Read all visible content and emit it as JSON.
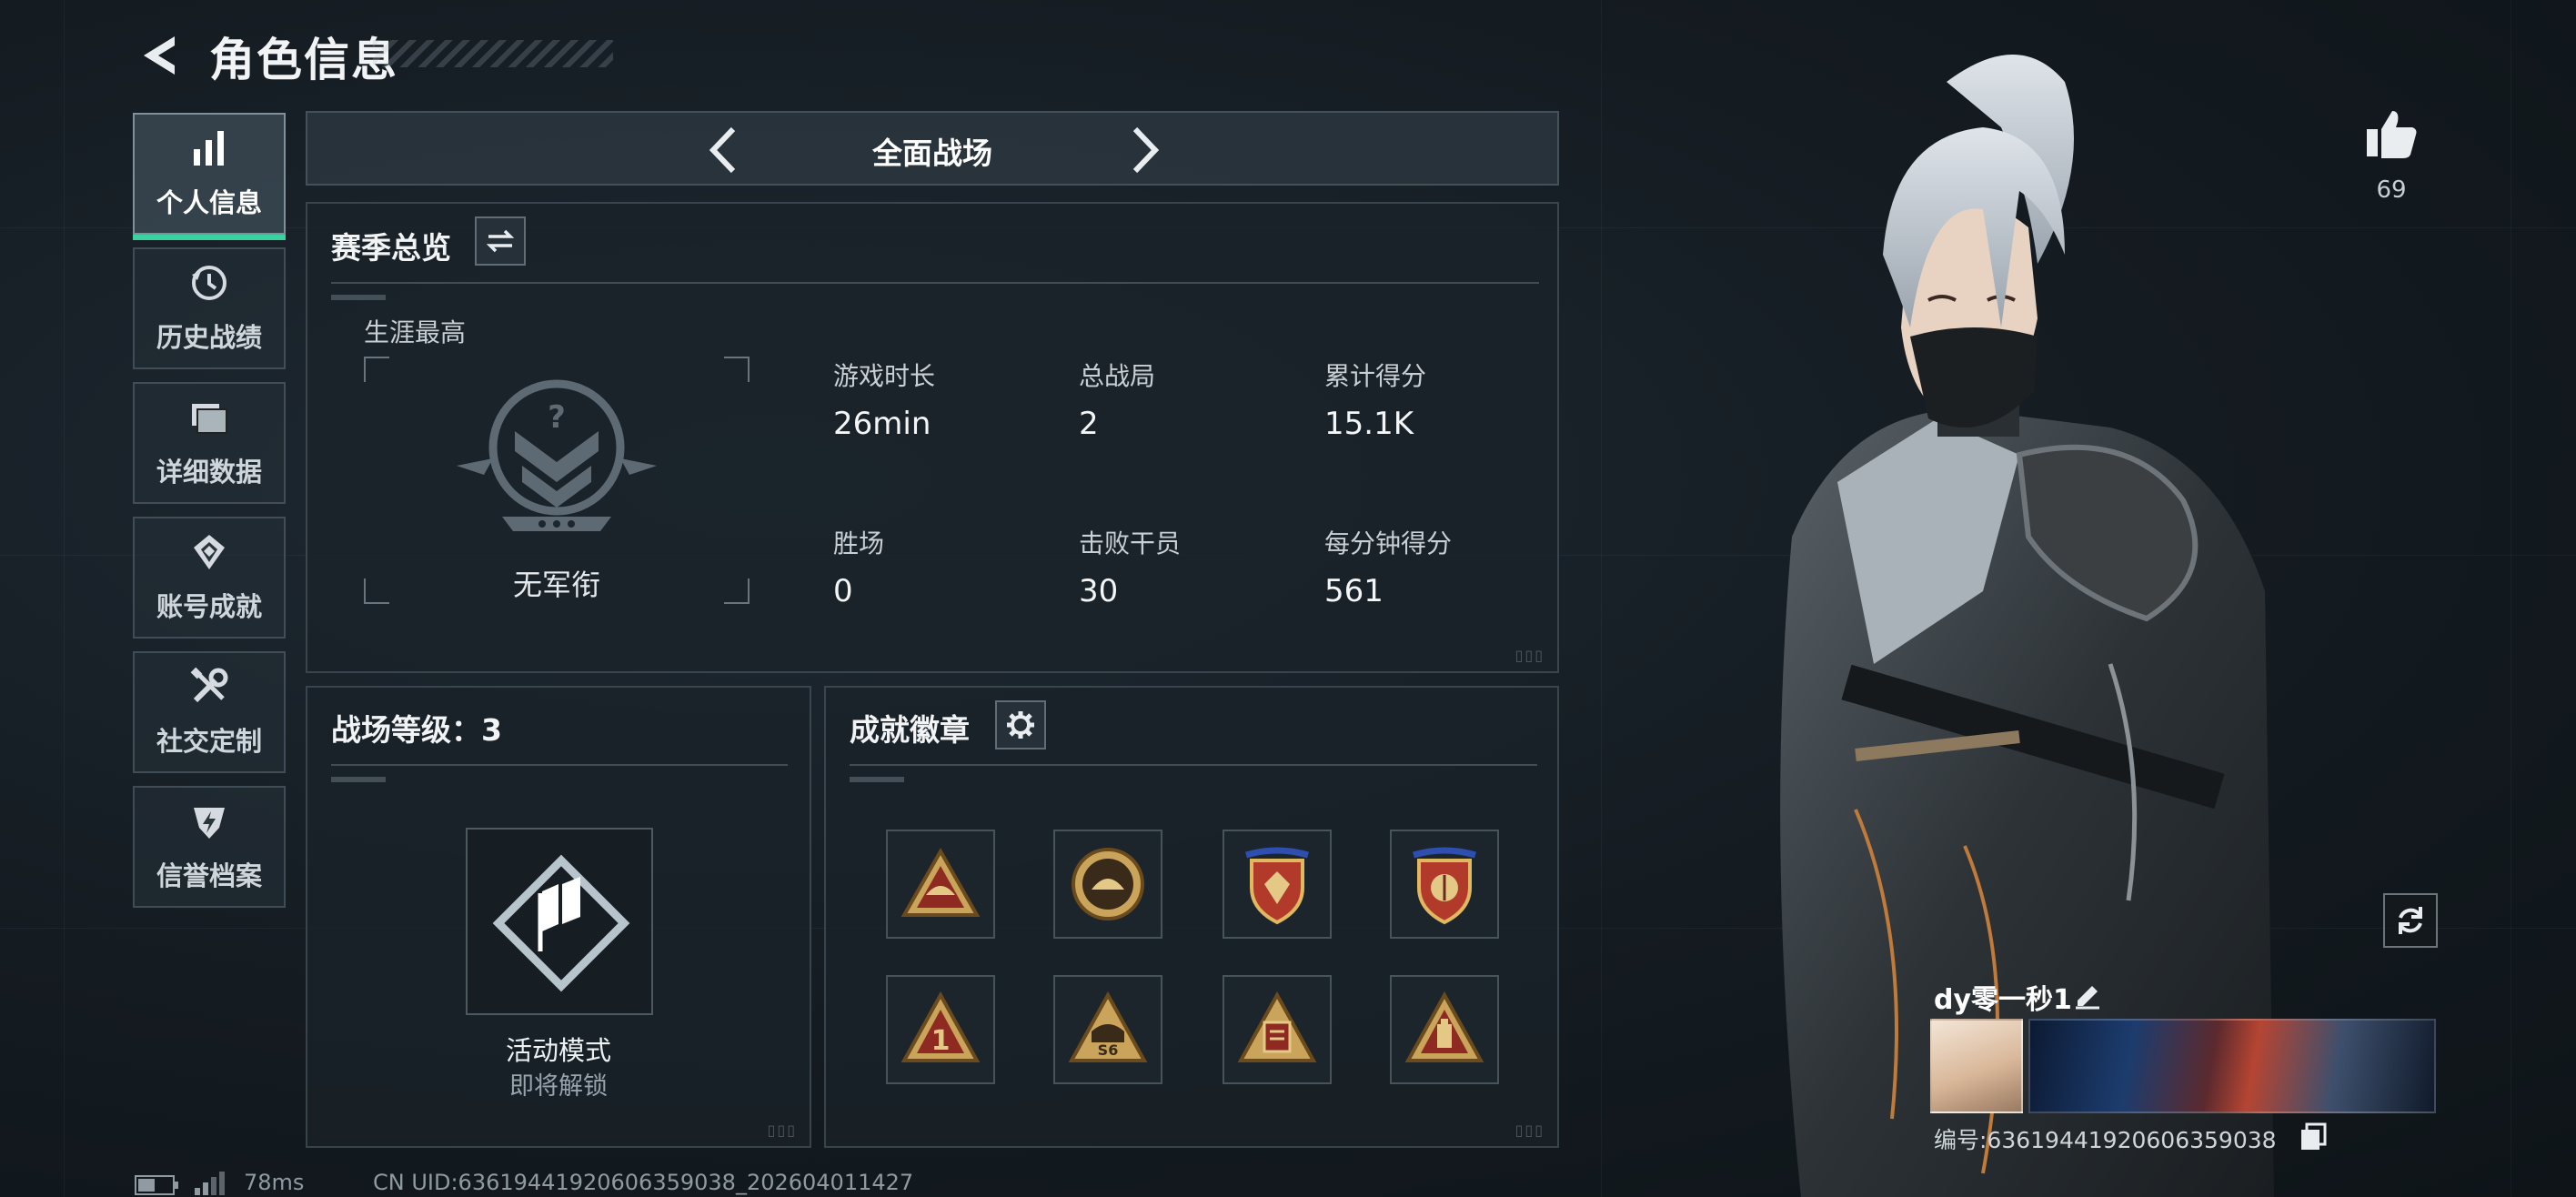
{
  "header": {
    "title": "角色信息"
  },
  "sidebar": {
    "items": [
      {
        "label": "个人信息",
        "icon": "bar-chart-icon",
        "active": true
      },
      {
        "label": "历史战绩",
        "icon": "history-icon",
        "active": false
      },
      {
        "label": "详细数据",
        "icon": "folder-icon",
        "active": false
      },
      {
        "label": "账号成就",
        "icon": "achievement-icon",
        "active": false
      },
      {
        "label": "社交定制",
        "icon": "tools-icon",
        "active": false
      },
      {
        "label": "信誉档案",
        "icon": "reputation-icon",
        "active": false
      }
    ]
  },
  "mode_switcher": {
    "title": "全面战场"
  },
  "season": {
    "title": "赛季总览",
    "career_label": "生涯最高",
    "rank_name": "无军衔",
    "stats": [
      {
        "label": "游戏时长",
        "value": "26min"
      },
      {
        "label": "总战局",
        "value": "2"
      },
      {
        "label": "累计得分",
        "value": "15.1K"
      },
      {
        "label": "胜场",
        "value": "0"
      },
      {
        "label": "击败干员",
        "value": "30"
      },
      {
        "label": "每分钟得分",
        "value": "561"
      }
    ]
  },
  "level": {
    "title": "战场等级：3",
    "mode_name": "活动模式",
    "mode_status": "即将解锁"
  },
  "badges": {
    "title": "成就徽章",
    "items": [
      {
        "icon": "triangle-badge-helmet-icon"
      },
      {
        "icon": "circle-badge-helmet-icon"
      },
      {
        "icon": "shield-badge-emblem-icon"
      },
      {
        "icon": "shield-badge-target-icon"
      },
      {
        "icon": "triangle-badge-one-icon",
        "text": "1"
      },
      {
        "icon": "triangle-badge-s6-icon",
        "text": "S6"
      },
      {
        "icon": "triangle-badge-book-icon"
      },
      {
        "icon": "triangle-badge-bottle-icon"
      }
    ]
  },
  "profile": {
    "likes": "69",
    "name": "dy零一秒1",
    "id_text": "编号:6361944192060635903​8"
  },
  "footer": {
    "ping": "78ms",
    "uid": "CN UID:636194419206063590​38_202604011427"
  },
  "colors": {
    "accent": "#38d39f",
    "badge_gold": "#c9a45a",
    "badge_red": "#8e2a22",
    "panel_border": "#5a6873"
  }
}
